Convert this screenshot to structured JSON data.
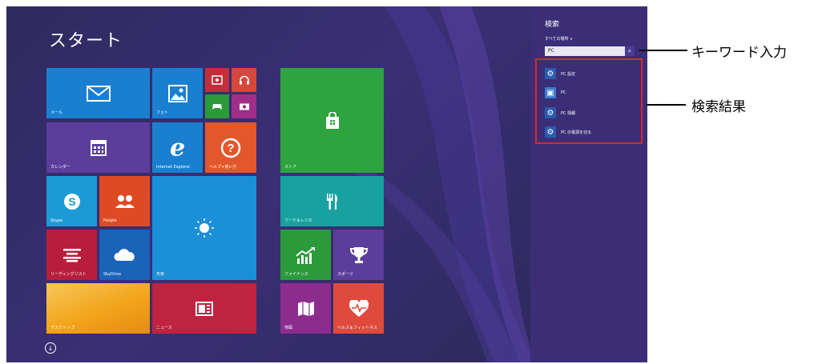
{
  "start": {
    "title": "スタート"
  },
  "tiles": {
    "mail": {
      "label": "メール",
      "color": "#1b7fd0",
      "icon": "mail-icon"
    },
    "photos": {
      "label": "フォト",
      "color": "#1b7fd0",
      "icon": "photo-icon"
    },
    "video": {
      "label": "",
      "color": "#c32e3a",
      "icon": "video-icon"
    },
    "music": {
      "label": "",
      "color": "#d4493b",
      "icon": "headphones-icon"
    },
    "games": {
      "label": "",
      "color": "#2a9a3b",
      "icon": "gamepad-icon"
    },
    "camera": {
      "label": "",
      "color": "#9f2e89",
      "icon": "camera-icon"
    },
    "store": {
      "label": "ストア",
      "color": "#2ea33f",
      "icon": "shopping-bag-icon"
    },
    "calendar": {
      "label": "カレンダー",
      "color": "#5b3e9b",
      "icon": "calendar-icon"
    },
    "ie": {
      "label": "Internet Explorer",
      "color": "#1b7fd0",
      "icon": "ie-icon"
    },
    "help": {
      "label": "ヘルプ+使い方",
      "color": "#e3572c",
      "icon": "help-icon"
    },
    "skype": {
      "label": "Skype",
      "color": "#1b9ad6",
      "icon": "skype-icon"
    },
    "people": {
      "label": "People",
      "color": "#de4a25",
      "icon": "people-icon"
    },
    "weather": {
      "label": "天気",
      "color": "#1c8fd9",
      "icon": "sun-icon"
    },
    "food": {
      "label": "フード＆レシピ",
      "color": "#17a2a0",
      "icon": "fork-knife-icon"
    },
    "reading": {
      "label": "リーディングリスト",
      "color": "#b81e3c",
      "icon": "reading-list-icon"
    },
    "skydrive": {
      "label": "SkyDrive",
      "color": "#1a63b8",
      "icon": "cloud-icon"
    },
    "finance": {
      "label": "ファイナンス",
      "color": "#2a9a3b",
      "icon": "chart-icon"
    },
    "sports": {
      "label": "スポーツ",
      "color": "#5b3e9b",
      "icon": "trophy-icon"
    },
    "desktop": {
      "label": "デスクトップ",
      "color": "#f2a41a",
      "icon": ""
    },
    "news": {
      "label": "ニュース",
      "color": "#c0233f",
      "icon": "news-icon"
    },
    "maps": {
      "label": "地図",
      "color": "#8c2d8e",
      "icon": "map-icon"
    },
    "health": {
      "label": "ヘルス＆フィットネス",
      "color": "#e04a3c",
      "icon": "heart-icon"
    }
  },
  "search": {
    "title": "検索",
    "scope": "すべての場所 ∨",
    "query": "PC",
    "results": [
      {
        "label": "PC 設定",
        "icon": "gear-icon"
      },
      {
        "label": "PC",
        "icon": "computer-icon"
      },
      {
        "label": "PC 情報",
        "icon": "gear-icon"
      },
      {
        "label": "PC の電源を切る",
        "icon": "gear-icon"
      }
    ]
  },
  "callouts": {
    "keyword": "キーワード入力",
    "results": "検索結果"
  }
}
